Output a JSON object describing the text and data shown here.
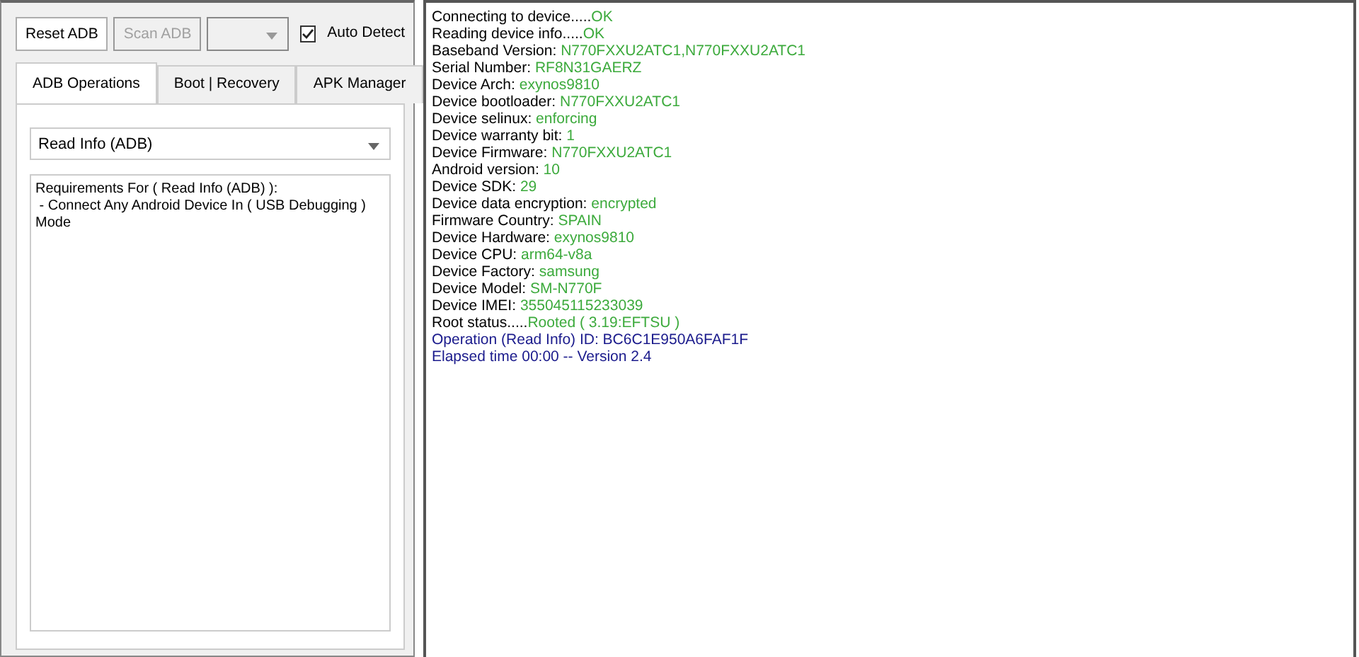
{
  "toolbar": {
    "buttons": [
      {
        "label": "Reset ADB",
        "disabled": false
      },
      {
        "label": "Scan ADB",
        "disabled": true
      }
    ],
    "port_select": {
      "disabled": true
    },
    "auto_detect": {
      "label": "Auto Detect",
      "checked": true
    }
  },
  "tabs": [
    {
      "label": "ADB Operations",
      "selected": true
    },
    {
      "label": "Boot | Recovery",
      "selected": false
    },
    {
      "label": "APK Manager",
      "selected": false
    }
  ],
  "operation_select": {
    "value": "Read Info (ADB)"
  },
  "requirements": {
    "lines": [
      "Requirements For ( Read Info (ADB) ):",
      " - Connect Any Android Device In ( USB Debugging ) Mode"
    ]
  },
  "log": [
    {
      "kind": "result",
      "label": "Connecting to device.....",
      "value": "OK"
    },
    {
      "kind": "result",
      "label": "Reading device info.....",
      "value": "OK"
    },
    {
      "kind": "result",
      "label": "Baseband Version: ",
      "value": "N770FXXU2ATC1,N770FXXU2ATC1"
    },
    {
      "kind": "result",
      "label": "Serial Number: ",
      "value": "RF8N31GAERZ"
    },
    {
      "kind": "result",
      "label": "Device Arch: ",
      "value": "exynos9810"
    },
    {
      "kind": "result",
      "label": "Device bootloader: ",
      "value": "N770FXXU2ATC1"
    },
    {
      "kind": "result",
      "label": "Device selinux: ",
      "value": "enforcing"
    },
    {
      "kind": "result",
      "label": "Device warranty bit: ",
      "value": "1"
    },
    {
      "kind": "result",
      "label": "Device Firmware: ",
      "value": "N770FXXU2ATC1"
    },
    {
      "kind": "result",
      "label": "Android version: ",
      "value": "10"
    },
    {
      "kind": "result",
      "label": "Device SDK: ",
      "value": "29"
    },
    {
      "kind": "result",
      "label": "Device data encryption: ",
      "value": "encrypted"
    },
    {
      "kind": "result",
      "label": "Firmware Country: ",
      "value": "SPAIN"
    },
    {
      "kind": "result",
      "label": "Device Hardware: ",
      "value": "exynos9810"
    },
    {
      "kind": "result",
      "label": "Device CPU: ",
      "value": "arm64-v8a"
    },
    {
      "kind": "result",
      "label": "Device Factory: ",
      "value": "samsung"
    },
    {
      "kind": "result",
      "label": "Device Model: ",
      "value": "SM-N770F"
    },
    {
      "kind": "result",
      "label": "Device IMEI: ",
      "value": "355045115233039"
    },
    {
      "kind": "result",
      "label": "Root status.....",
      "value": "Rooted ( 3.19:EFTSU )"
    },
    {
      "kind": "info",
      "label": "Operation (Read Info) ID: BC6C1E950A6FAF1F"
    },
    {
      "kind": "info",
      "label": "Elapsed time 00:00 -- Version 2.4"
    }
  ]
}
